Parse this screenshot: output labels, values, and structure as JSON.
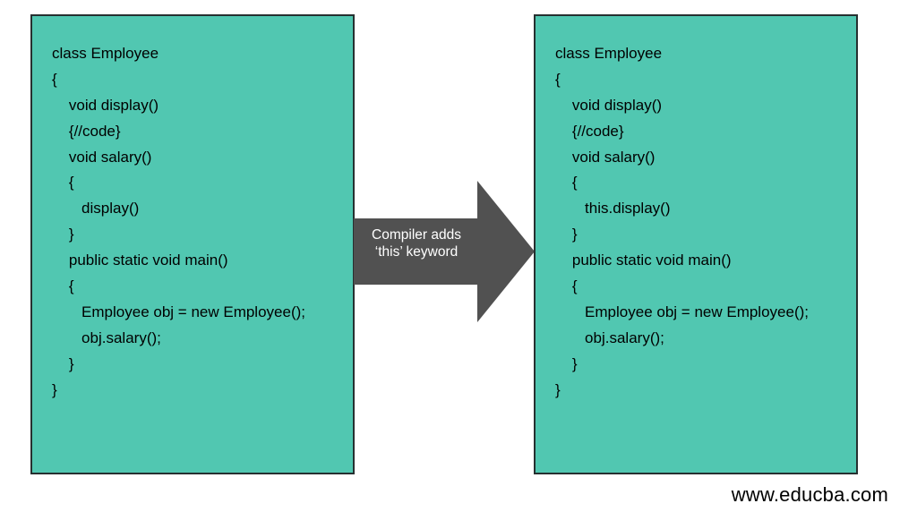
{
  "left_box": {
    "lines": [
      "class Employee",
      "{",
      "    void display()",
      "    {//code}",
      "    void salary()",
      "    {",
      "       display()",
      "    }",
      "    public static void main()",
      "    {",
      "       Employee obj = new Employee();",
      "       obj.salary();",
      "    }",
      "}"
    ]
  },
  "right_box": {
    "lines": [
      "class Employee",
      "{",
      "    void display()",
      "    {//code}",
      "    void salary()",
      "    {",
      "       this.display()",
      "    }",
      "    public static void main()",
      "    {",
      "       Employee obj = new Employee();",
      "       obj.salary();",
      "    }",
      "}"
    ]
  },
  "arrow": {
    "label_line1": "Compiler adds",
    "label_line2": "‘this’ keyword",
    "fill": "#515151"
  },
  "colors": {
    "box_bg": "#51c7b1",
    "box_border": "#263030"
  },
  "attribution": "www.educba.com"
}
